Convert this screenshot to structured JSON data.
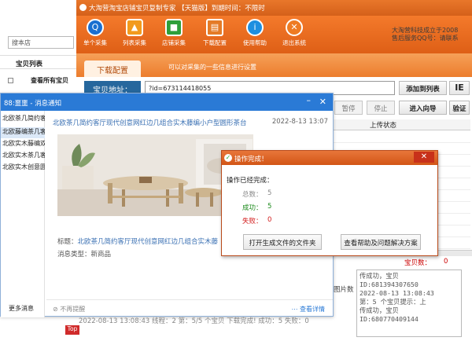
{
  "left_app": {
    "search_placeholder": "搜本店",
    "list_header": "宝贝列表",
    "list_row": "查看所有宝贝"
  },
  "main_window": {
    "title": "大淘营淘宝店铺宝贝复制专家 【天猫版】到期时间：不限时",
    "toolbar": [
      {
        "label": "单个采集",
        "icon": "single-collect-icon",
        "color": "#1a6fd0",
        "glyph": "Q"
      },
      {
        "label": "列表采集",
        "icon": "list-collect-icon",
        "color": "#f29a1d",
        "glyph": "▲"
      },
      {
        "label": "店铺采集",
        "icon": "shop-collect-icon",
        "color": "#2e9f3a",
        "glyph": "■"
      },
      {
        "label": "下载配置",
        "icon": "download-config-icon",
        "color": "#e47b27",
        "glyph": "▤"
      },
      {
        "label": "使用帮助",
        "icon": "help-icon",
        "color": "#1d8fe0",
        "glyph": "i"
      },
      {
        "label": "退出系统",
        "icon": "exit-icon",
        "color": "#ee7b23",
        "glyph": "✕"
      }
    ],
    "right_info_line1": "大淘营科技成立于2008",
    "right_info_line2": "售后服务QQ号：请联系",
    "tab_label": "下载配置",
    "tab_hint": "可以对采集的一些信息进行设置",
    "address_label": "宝贝地址：",
    "address_value": "?id=673114418055",
    "add_to_list_button": "添加到列表",
    "ie_button": "IE",
    "pause_button": "暂停",
    "stop_button": "停止",
    "import_wizard_button": "进入向导",
    "verify_button": "验证",
    "upload_status_header": "上传状态",
    "item_count_label": "宝贝数：",
    "item_count_value": "0",
    "image_count_label": "图片数",
    "log_lines": [
      "传成功，宝贝",
      "ID:681394307650",
      "2022-08-13 13:08:43",
      "第：5 个宝贝提示：上",
      "传成功，宝贝",
      "ID:680770409144"
    ],
    "status_line": "2022-08-13 13:08:43 线程：2 第：5/5 个宝贝 下载完成! 成功：5 失败：0"
  },
  "notification": {
    "title": "88:噩噩 - 消息通知",
    "list_items": [
      "北欧茶几简约客厅...",
      "北欧藤编茶几客厅...",
      "北欧实木藤编双层...",
      "北欧实木茶几客厅...",
      "北欧实木创意圆形..."
    ],
    "more_label": "更多消息",
    "item_title": "北欧茶几简约客厅现代创意网红边几组合实木藤编小户型圆形茶台",
    "item_date": "2022-8-13 13:07",
    "detail_title_label": "标题：",
    "detail_title_value": "北欧茶几简约客厅现代创意网红边几组合实木藤",
    "message_type": "消息类型：新商品",
    "no_remind": "不再提醒",
    "view_detail": "查看详情"
  },
  "dialog": {
    "title": "操作完成！",
    "completed_label": "操作已经完成：",
    "total_label": "总数：",
    "total_value": "5",
    "success_label": "成功：",
    "success_value": "5",
    "fail_label": "失败：",
    "fail_value": "0",
    "open_folder_button": "打开生成文件的文件夹",
    "help_button": "查看帮助及问题解决方案"
  },
  "ad_badge": "Top"
}
